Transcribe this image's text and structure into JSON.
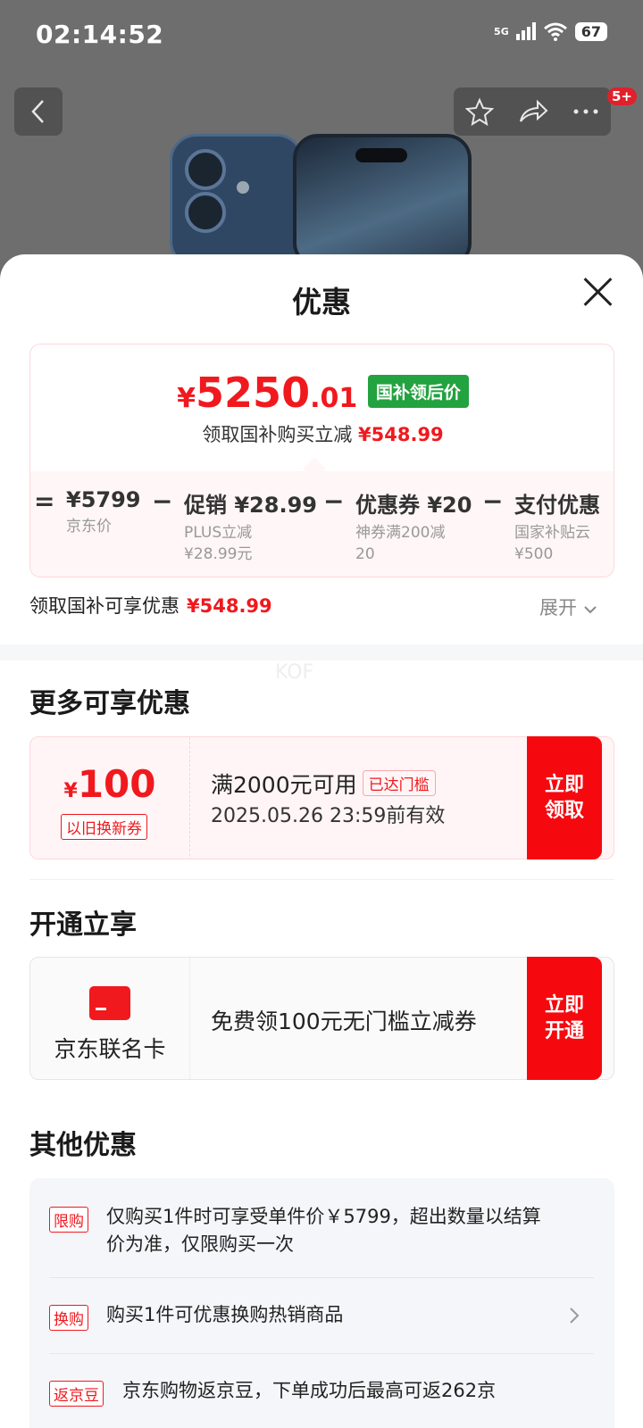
{
  "status": {
    "time": "02:14:52",
    "network": "5G",
    "battery": "67"
  },
  "top_nav": {
    "back_icon": "chevron-left-icon",
    "cart_badge": "5+"
  },
  "sheet": {
    "title": "优惠",
    "price": {
      "currency": "¥",
      "integer": "5250",
      "decimal": ".01",
      "tag": "国补领后价"
    },
    "subtitle": {
      "text": "领取国补购买立减",
      "amount": "¥548.99"
    },
    "breakdown": [
      {
        "op": "=",
        "value": "¥5799",
        "desc": "京东价"
      },
      {
        "op": "−",
        "value": "促销 ¥28.99",
        "desc": "PLUS立减 ¥28.99元"
      },
      {
        "op": "−",
        "value": "优惠券 ¥20",
        "desc": "神券满200减20"
      },
      {
        "op": "−",
        "value": "支付优惠",
        "desc": "国家补贴云 ¥500"
      }
    ],
    "gov_subsidy": {
      "text": "领取国补可享优惠",
      "amount": "¥548.99",
      "expand": "展开"
    },
    "watermark": "KOF"
  },
  "more_discounts": {
    "title": "更多可享优惠",
    "coupon": {
      "currency": "¥",
      "amount": "100",
      "type": "以旧换新券",
      "condition": "满2000元可用",
      "chip": "已达门槛",
      "expiry": "2025.05.26 23:59前有效",
      "button": "立即领取"
    }
  },
  "open_now": {
    "title": "开通立享",
    "card_name": "京东联名卡",
    "text": "免费领100元无门槛立减券",
    "button": "立即开通"
  },
  "other": {
    "title": "其他优惠",
    "rows": [
      {
        "tag": "限购",
        "text": "仅购买1件时可享受单件价￥5799，超出数量以结算价为准，仅限购买一次"
      },
      {
        "tag": "换购",
        "text": "购买1件可优惠换购热销商品"
      },
      {
        "tag": "返京豆",
        "text": "京东购物返京豆，下单成功后最高可返262京"
      }
    ]
  }
}
